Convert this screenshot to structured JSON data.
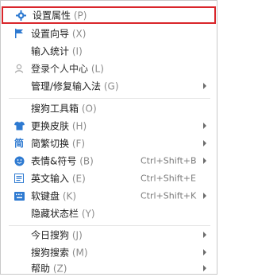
{
  "menu": {
    "items": [
      {
        "label": "设置属性",
        "key": "(P)",
        "icon": "gear-icon",
        "submenu": false,
        "highlight": true
      },
      {
        "label": "设置向导",
        "key": "(X)",
        "icon": "flag-icon",
        "submenu": false
      },
      {
        "label": "输入统计",
        "key": "(I)",
        "icon": "",
        "submenu": false
      },
      {
        "label": "登录个人中心",
        "key": "(L)",
        "icon": "user-icon",
        "submenu": false
      },
      {
        "label": "管理/修复输入法",
        "key": "(G)",
        "icon": "",
        "submenu": true
      },
      {
        "label": "搜狗工具箱",
        "key": "(O)",
        "icon": "",
        "submenu": false
      },
      {
        "label": "更换皮肤",
        "key": "(H)",
        "icon": "shirt-icon",
        "submenu": true
      },
      {
        "label": "简繁切换",
        "key": "(F)",
        "icon": "simplified-traditional-icon",
        "submenu": true
      },
      {
        "label": "表情&符号",
        "key": "(B)",
        "icon": "smiley-icon",
        "shortcut": "Ctrl+Shift+B",
        "submenu": true
      },
      {
        "label": "英文输入",
        "key": "(E)",
        "icon": "english-input-icon",
        "shortcut": "Ctrl+Shift+E",
        "submenu": false
      },
      {
        "label": "软键盘",
        "key": "(K)",
        "icon": "keyboard-icon",
        "shortcut": "Ctrl+Shift+K",
        "submenu": true
      },
      {
        "label": "隐藏状态栏",
        "key": "(Y)",
        "icon": "",
        "submenu": false
      },
      {
        "label": "今日搜狗",
        "key": "(J)",
        "icon": "",
        "submenu": true
      },
      {
        "label": "搜狗搜索",
        "key": "(M)",
        "icon": "",
        "submenu": true
      },
      {
        "label": "帮助",
        "key": "(Z)",
        "icon": "",
        "submenu": true
      }
    ],
    "icon_glyphs": {
      "simplified-traditional-icon": "简"
    }
  }
}
